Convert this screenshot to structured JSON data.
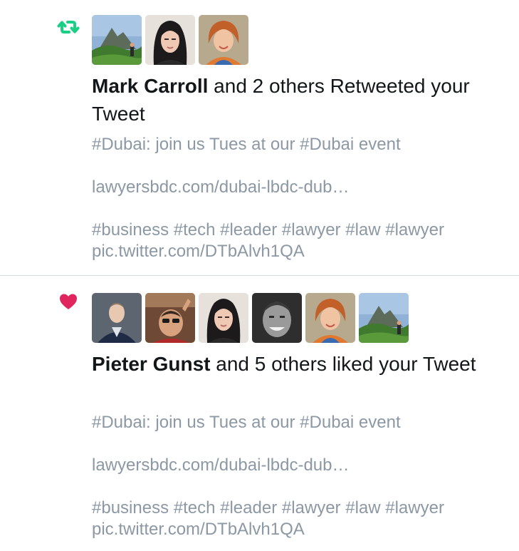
{
  "notifications": [
    {
      "type": "retweet",
      "icon": "retweet-icon",
      "icon_color": "#19cf86",
      "actor": "Mark Carroll",
      "action_text": " and 2 others Retweeted your Tweet",
      "tweet": {
        "line1": "#Dubai: join us Tues at our #Dubai event",
        "link": "lawyersbdc.com/dubai-lbdc-dub…",
        "hashtags": "#business #tech #leader #lawyer #law #lawyer",
        "pic_link": "pic.twitter.com/DTbAlvh1QA"
      }
    },
    {
      "type": "like",
      "icon": "heart-icon",
      "icon_color": "#e0245e",
      "actor": "Pieter Gunst",
      "action_text": " and 5 others liked your Tweet",
      "tweet": {
        "line1": "#Dubai: join us Tues at our #Dubai event",
        "link": "lawyersbdc.com/dubai-lbdc-dub…",
        "hashtags": "#business #tech #leader #lawyer #law #lawyer",
        "pic_link": "pic.twitter.com/DTbAlvh1QA"
      }
    }
  ],
  "colors": {
    "text_primary": "#14171a",
    "text_secondary": "#8c98a4",
    "divider": "#d6dbdf"
  }
}
